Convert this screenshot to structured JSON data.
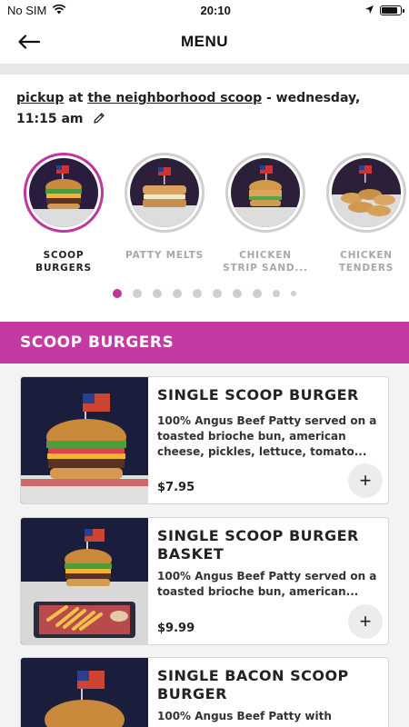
{
  "status_bar": {
    "carrier": "No SIM",
    "time": "20:10",
    "battery_level": 0.9
  },
  "header": {
    "title": "MENU"
  },
  "pickup": {
    "mode": "pickup",
    "connector": "at",
    "location": "the neighborhood scoop",
    "schedule": "- wednesday, 11:15 am"
  },
  "categories": [
    {
      "label": "SCOOP BURGERS",
      "active": true
    },
    {
      "label": "PATTY MELTS",
      "active": false
    },
    {
      "label": "CHICKEN STRIP SAND...",
      "active": false
    },
    {
      "label": "CHICKEN TENDERS",
      "active": false
    }
  ],
  "pagination": {
    "total": 10,
    "current": 1
  },
  "section": {
    "title": "SCOOP BURGERS"
  },
  "items": [
    {
      "name": "SINGLE SCOOP BURGER",
      "description": "100% Angus Beef Patty served on a toasted brioche bun, american cheese, pickles, lettuce, tomato...",
      "price": "$7.95"
    },
    {
      "name": "SINGLE SCOOP BURGER BASKET",
      "description": "100% Angus Beef Patty served on a toasted brioche bun, american...",
      "price": "$9.99"
    },
    {
      "name": "SINGLE BACON SCOOP BURGER",
      "description": "100% Angus Beef Patty with",
      "price": ""
    }
  ],
  "add_button_symbol": "+",
  "colors": {
    "accent": "#c43aa3",
    "active_ring": "#c0359e"
  }
}
